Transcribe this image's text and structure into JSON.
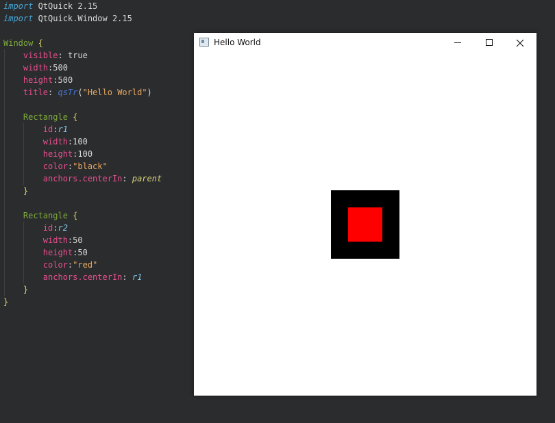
{
  "editor": {
    "lines": [
      [
        {
          "t": "import",
          "c": "kw"
        },
        {
          "t": " QtQuick 2.15",
          "c": "plain"
        }
      ],
      [
        {
          "t": "import",
          "c": "kw"
        },
        {
          "t": " QtQuick.Window 2.15",
          "c": "plain"
        }
      ],
      [],
      [
        {
          "t": "Window",
          "c": "type"
        },
        {
          "t": " {",
          "c": "brace"
        }
      ],
      [
        {
          "t": "    ",
          "c": "plain"
        },
        {
          "t": "visible",
          "c": "prop"
        },
        {
          "t": ": ",
          "c": "punc"
        },
        {
          "t": "true",
          "c": "plain"
        }
      ],
      [
        {
          "t": "    ",
          "c": "plain"
        },
        {
          "t": "width",
          "c": "prop"
        },
        {
          "t": ":",
          "c": "punc"
        },
        {
          "t": "500",
          "c": "plain"
        }
      ],
      [
        {
          "t": "    ",
          "c": "plain"
        },
        {
          "t": "height",
          "c": "prop"
        },
        {
          "t": ":",
          "c": "punc"
        },
        {
          "t": "500",
          "c": "plain"
        }
      ],
      [
        {
          "t": "    ",
          "c": "plain"
        },
        {
          "t": "title",
          "c": "prop"
        },
        {
          "t": ": ",
          "c": "punc"
        },
        {
          "t": "qsTr",
          "c": "fn"
        },
        {
          "t": "(",
          "c": "punc"
        },
        {
          "t": "\"Hello World\"",
          "c": "str"
        },
        {
          "t": ")",
          "c": "punc"
        }
      ],
      [],
      [
        {
          "t": "    ",
          "c": "plain"
        },
        {
          "t": "Rectangle",
          "c": "type"
        },
        {
          "t": " {",
          "c": "brace"
        }
      ],
      [
        {
          "t": "        ",
          "c": "plain"
        },
        {
          "t": "id",
          "c": "prop"
        },
        {
          "t": ":",
          "c": "punc"
        },
        {
          "t": "r1",
          "c": "id"
        }
      ],
      [
        {
          "t": "        ",
          "c": "plain"
        },
        {
          "t": "width",
          "c": "prop"
        },
        {
          "t": ":",
          "c": "punc"
        },
        {
          "t": "100",
          "c": "plain"
        }
      ],
      [
        {
          "t": "        ",
          "c": "plain"
        },
        {
          "t": "height",
          "c": "prop"
        },
        {
          "t": ":",
          "c": "punc"
        },
        {
          "t": "100",
          "c": "plain"
        }
      ],
      [
        {
          "t": "        ",
          "c": "plain"
        },
        {
          "t": "color",
          "c": "prop"
        },
        {
          "t": ":",
          "c": "punc"
        },
        {
          "t": "\"black\"",
          "c": "str"
        }
      ],
      [
        {
          "t": "        ",
          "c": "plain"
        },
        {
          "t": "anchors.centerIn",
          "c": "prop"
        },
        {
          "t": ": ",
          "c": "punc"
        },
        {
          "t": "parent",
          "c": "par"
        }
      ],
      [
        {
          "t": "    ",
          "c": "plain"
        },
        {
          "t": "}",
          "c": "brace"
        }
      ],
      [],
      [
        {
          "t": "    ",
          "c": "plain"
        },
        {
          "t": "Rectangle",
          "c": "type"
        },
        {
          "t": " {",
          "c": "brace"
        }
      ],
      [
        {
          "t": "        ",
          "c": "plain"
        },
        {
          "t": "id",
          "c": "prop"
        },
        {
          "t": ":",
          "c": "punc"
        },
        {
          "t": "r2",
          "c": "id"
        }
      ],
      [
        {
          "t": "        ",
          "c": "plain"
        },
        {
          "t": "width",
          "c": "prop"
        },
        {
          "t": ":",
          "c": "punc"
        },
        {
          "t": "50",
          "c": "plain"
        }
      ],
      [
        {
          "t": "        ",
          "c": "plain"
        },
        {
          "t": "height",
          "c": "prop"
        },
        {
          "t": ":",
          "c": "punc"
        },
        {
          "t": "50",
          "c": "plain"
        }
      ],
      [
        {
          "t": "        ",
          "c": "plain"
        },
        {
          "t": "color",
          "c": "prop"
        },
        {
          "t": ":",
          "c": "punc"
        },
        {
          "t": "\"red\"",
          "c": "str"
        }
      ],
      [
        {
          "t": "        ",
          "c": "plain"
        },
        {
          "t": "anchors.centerIn",
          "c": "prop"
        },
        {
          "t": ": ",
          "c": "punc"
        },
        {
          "t": "r1",
          "c": "id"
        }
      ],
      [
        {
          "t": "    ",
          "c": "plain"
        },
        {
          "t": "}",
          "c": "brace"
        }
      ],
      [
        {
          "t": "}",
          "c": "brace"
        }
      ]
    ]
  },
  "app_window": {
    "title": "Hello World",
    "icon": "app-window-icon",
    "controls": {
      "minimize_icon": "minimize-icon",
      "maximize_icon": "maximize-icon",
      "close_icon": "close-icon"
    },
    "rectangles": [
      {
        "id": "r1",
        "color": "#000000"
      },
      {
        "id": "r2",
        "color": "#ff0000"
      }
    ]
  }
}
